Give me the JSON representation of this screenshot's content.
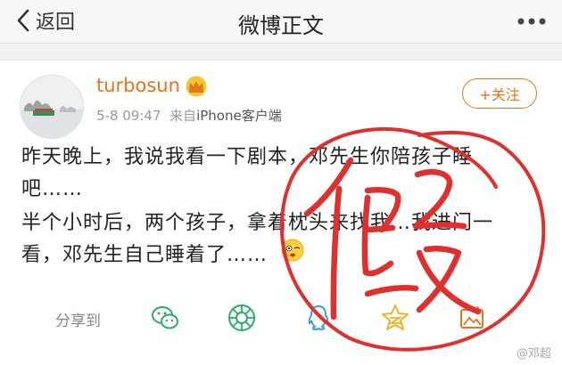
{
  "nav": {
    "back_label": "返回",
    "title": "微博正文"
  },
  "post": {
    "username": "turbosun",
    "timestamp": "5-8 09:47",
    "source_prefix": "来自",
    "source": "iPhone客户端",
    "follow_label": "+关注",
    "lines": [
      "昨天晚上，我说我看一下剧本，邓先生你陪孩子睡",
      "吧……",
      "半个小时后，两个孩子，拿着枕头来找我…我进门一",
      "看，邓先生自己睡着了……"
    ]
  },
  "share": {
    "label": "分享到",
    "targets": [
      "wechat-icon",
      "moments-icon",
      "qq-icon",
      "qzone-icon",
      "album-icon"
    ]
  },
  "stamp_text": "假",
  "watermark": "@邓超",
  "colors": {
    "accent": "#e8731d",
    "stamp": "#e0302e"
  }
}
